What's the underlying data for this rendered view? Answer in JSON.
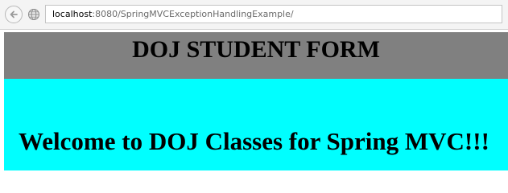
{
  "browser": {
    "url_host": "localhost",
    "url_path": ":8080/SpringMVCExceptionHandlingExample/",
    "back_icon": "back-arrow-icon",
    "forward_icon": "forward-globe-icon"
  },
  "page": {
    "header_title": "DOJ STUDENT FORM",
    "welcome_message": "Welcome to DOJ Classes for Spring MVC!!!"
  },
  "colors": {
    "header_background": "#808080",
    "body_background": "#00ffff",
    "text": "#000000"
  }
}
